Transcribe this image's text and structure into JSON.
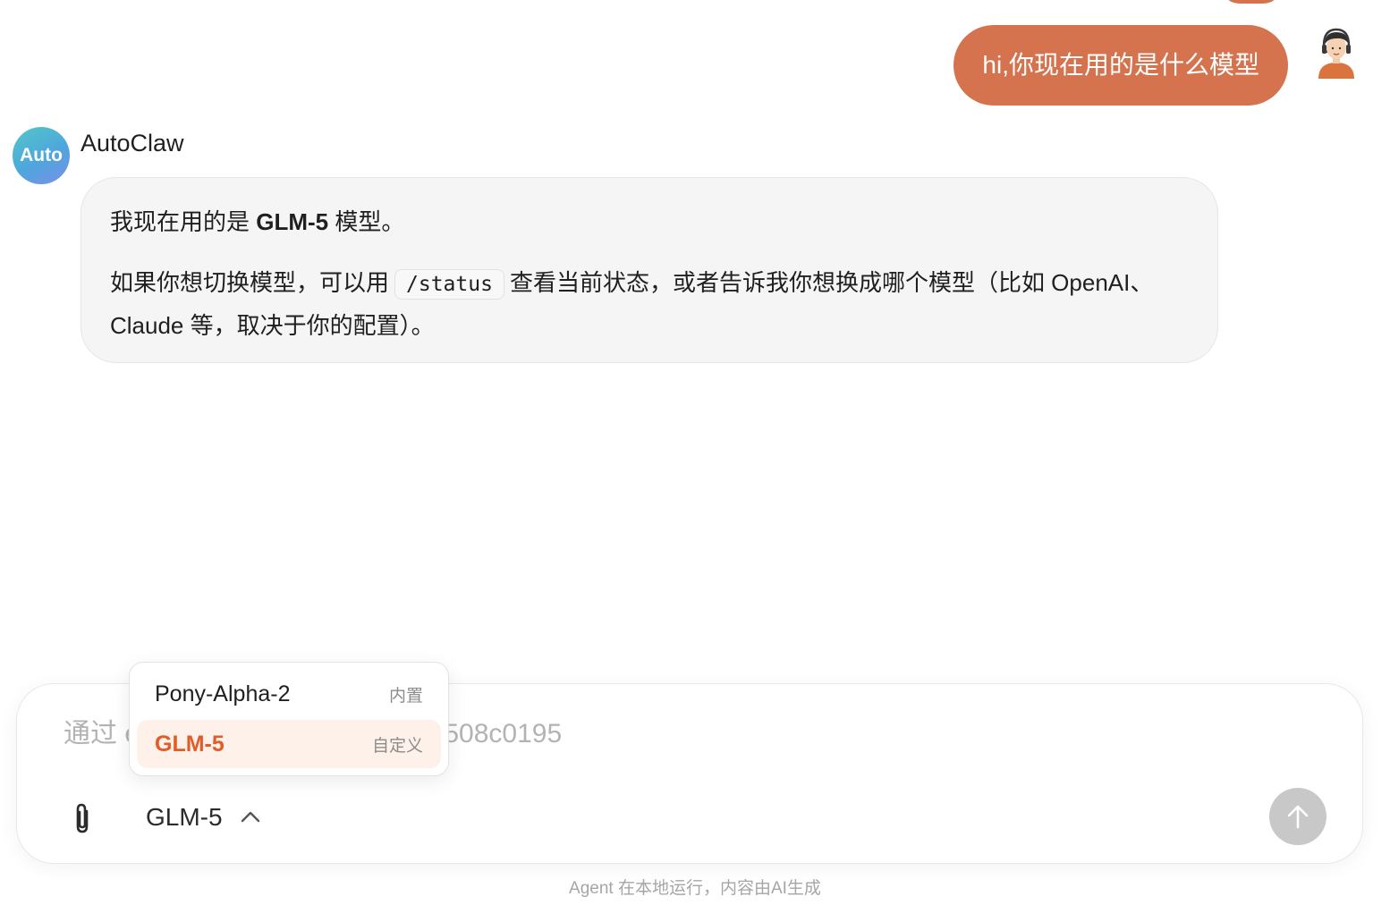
{
  "colors": {
    "accent": "#d4734e",
    "selected_text": "#e05d2a",
    "selected_bg": "#fdf1ea",
    "send_disabled": "#c8c8c8"
  },
  "user_message": {
    "text": "hi,你现在用的是什么模型",
    "avatar_icon": "user-avatar-icon"
  },
  "assistant": {
    "avatar_text": "Auto",
    "name": "AutoClaw",
    "message": {
      "p1_before": "我现在用的是 ",
      "p1_bold": "GLM-5",
      "p1_after": " 模型。",
      "p2_before": "如果你想切换模型，可以用",
      "p2_code": "/status",
      "p2_after": "查看当前状态，或者告诉我你想换成哪个模型（比如 OpenAI、Claude 等，取决于你的配置）。"
    }
  },
  "composer": {
    "placeholder": "通过 ec5a8a56f2b9b9a829f39df508c0195",
    "attach_icon": "paperclip-icon",
    "selected_model": "GLM-5",
    "chevron_icon": "chevron-up-icon",
    "send_icon": "arrow-up-icon"
  },
  "model_dropdown": {
    "options": [
      {
        "name": "Pony-Alpha-2",
        "tag": "内置"
      },
      {
        "name": "GLM-5",
        "tag": "自定义"
      }
    ]
  },
  "footer": {
    "note": "Agent 在本地运行，内容由AI生成"
  }
}
